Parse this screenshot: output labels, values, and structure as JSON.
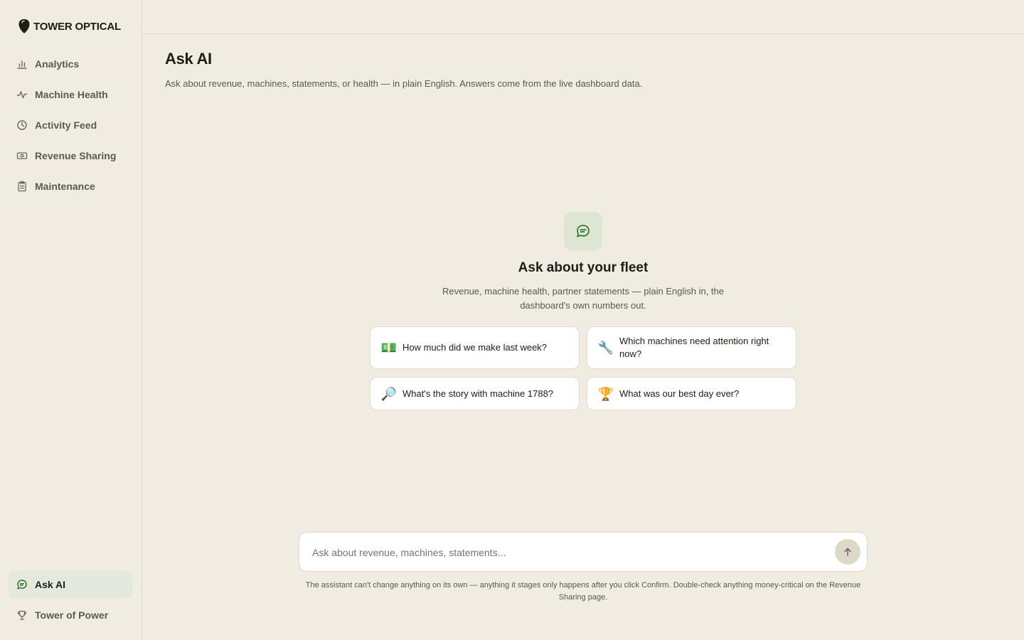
{
  "brand": {
    "name": "TOWER OPTICAL"
  },
  "nav": {
    "items": [
      {
        "label": "Analytics",
        "icon": "bar-chart-icon"
      },
      {
        "label": "Machine Health",
        "icon": "pulse-icon"
      },
      {
        "label": "Activity Feed",
        "icon": "clock-icon"
      },
      {
        "label": "Revenue Sharing",
        "icon": "banknote-icon"
      },
      {
        "label": "Maintenance",
        "icon": "clipboard-icon"
      }
    ],
    "bottom_items": [
      {
        "label": "Ask AI",
        "icon": "chat-icon",
        "active": true
      },
      {
        "label": "Tower of Power",
        "icon": "trophy-icon",
        "active": false
      }
    ]
  },
  "page": {
    "title": "Ask AI",
    "subtitle": "Ask about revenue, machines, statements, or health — in plain English. Answers come from the live dashboard data."
  },
  "hero": {
    "icon": "chat-bubble-icon",
    "title": "Ask about your fleet",
    "subtitle": "Revenue, machine health, partner statements — plain English in, the dashboard's own numbers out."
  },
  "suggestions": [
    {
      "emoji": "💵",
      "text": "How much did we make last week?"
    },
    {
      "emoji": "🔧",
      "text": "Which machines need attention right now?"
    },
    {
      "emoji": "🔎",
      "text": "What's the story with machine 1788?"
    },
    {
      "emoji": "🏆",
      "text": "What was our best day ever?"
    }
  ],
  "composer": {
    "placeholder": "Ask about revenue, machines, statements...",
    "value": "",
    "send_icon": "arrow-up-icon"
  },
  "disclaimer": "The assistant can't change anything on its own — anything it stages only happens after you click Confirm. Double-check anything money-critical on the Revenue Sharing page.",
  "colors": {
    "background": "#f0ece1",
    "active_nav": "#e3eadd",
    "accent_green": "#3f7a3a",
    "card": "#ffffff",
    "border": "#e0dbcd"
  }
}
